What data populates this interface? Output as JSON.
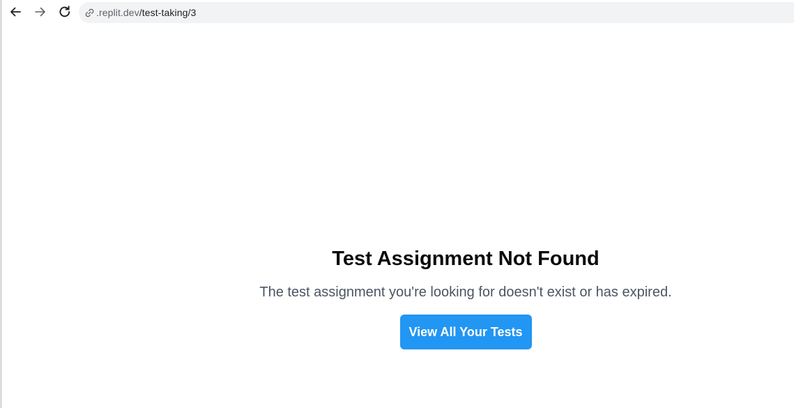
{
  "browser": {
    "back_icon": "arrow-left-icon",
    "forward_icon": "arrow-right-icon",
    "reload_icon": "reload-icon",
    "address": {
      "icon": "link-icon",
      "domain": ".replit.dev",
      "path": "/test-taking/3"
    }
  },
  "main": {
    "title": "Test Assignment Not Found",
    "message": "The test assignment you're looking for doesn't exist or has expired.",
    "button_label": "View All Your Tests"
  },
  "colors": {
    "button_bg": "#2196f3",
    "button_text": "#ffffff",
    "title": "#0b0b0b",
    "message": "#4b5563",
    "address_bar_bg": "#f1f3f4"
  }
}
